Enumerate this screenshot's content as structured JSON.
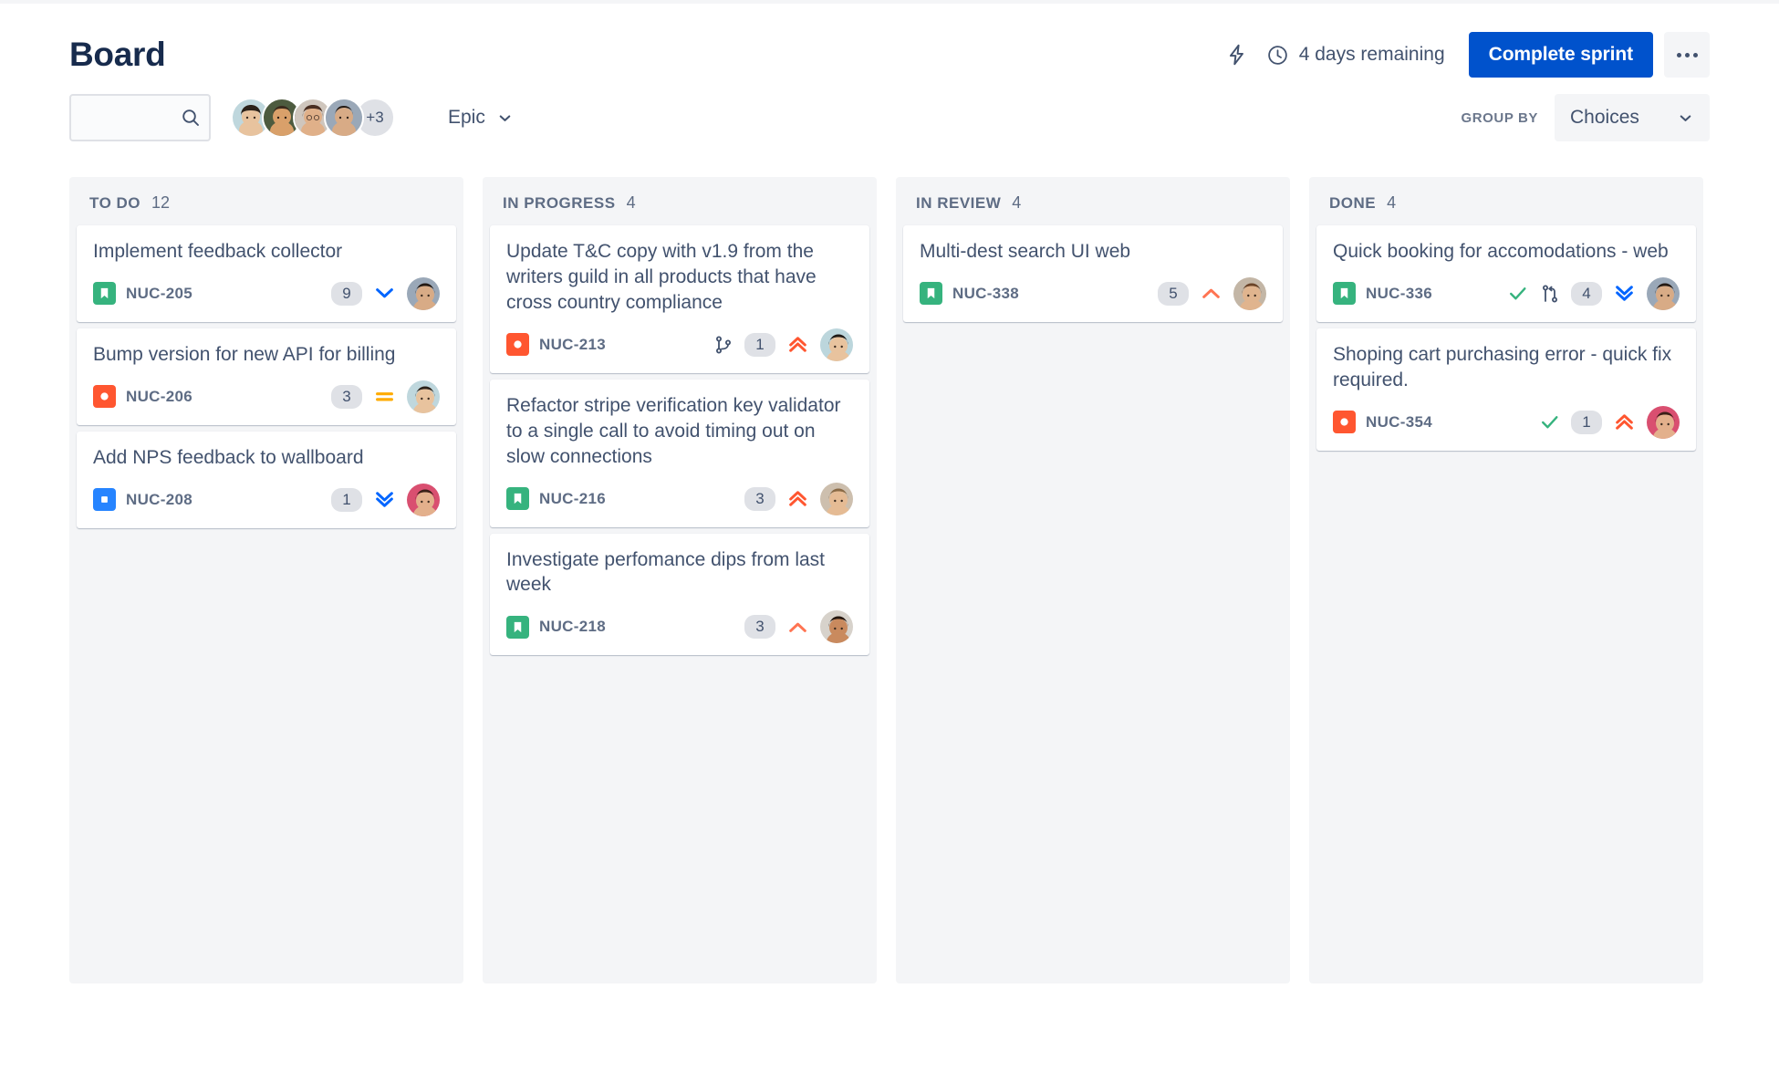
{
  "header": {
    "title": "Board",
    "lightning_icon": "lightning-bolt-icon",
    "clock_icon": "clock-icon",
    "days_remaining": "4 days remaining",
    "complete_sprint_label": "Complete sprint",
    "more_actions_icon": "ellipsis-icon"
  },
  "toolbar": {
    "search": {
      "value": "",
      "placeholder": "",
      "icon": "search-icon"
    },
    "avatars": [
      {
        "name": "avatar-1",
        "skin": "#e8c39e",
        "hair": "#2b2119",
        "bg": "#c9dde2"
      },
      {
        "name": "avatar-2",
        "skin": "#d9a06a",
        "hair": "#3b2a1d",
        "bg": "#4d5b3f"
      },
      {
        "name": "avatar-3",
        "skin": "#e0b089",
        "hair": "#4a2f22",
        "bg": "#cfc6bd"
      },
      {
        "name": "avatar-4",
        "skin": "#d8ab86",
        "hair": "#241a14",
        "bg": "#9aa8b8"
      }
    ],
    "avatar_overflow": "+3",
    "epic_label": "Epic",
    "group_by_label": "GROUP BY",
    "group_by_value": "Choices",
    "chevron_icon": "chevron-down-icon"
  },
  "colors": {
    "brand_blue": "#0052cc",
    "story_green": "#36b37e",
    "bug_red": "#ff5630",
    "task_blue": "#2684ff",
    "priority_highest": "#ff5630",
    "priority_high": "#ff7452",
    "priority_medium": "#ffab00",
    "priority_low": "#0065ff",
    "column_bg": "#f4f5f7",
    "text_primary": "#172b4d",
    "text_secondary": "#42526e",
    "text_muted": "#5e6c84"
  },
  "columns": [
    {
      "name": "TO DO",
      "count": "12",
      "cards": [
        {
          "title": "Implement feedback collector",
          "key": "NUC-205",
          "type": "story",
          "type_icon": "story-bookmark-icon",
          "count": "9",
          "priority": "low",
          "priority_icon": "chevron-down-icon",
          "check": false,
          "branch": null,
          "avatar": {
            "skin": "#d8ab86",
            "hair": "#241a14",
            "bg": "#9aa8b8"
          }
        },
        {
          "title": "Bump version for new API for billing",
          "key": "NUC-206",
          "type": "bug",
          "type_icon": "bug-circle-icon",
          "count": "3",
          "priority": "medium",
          "priority_icon": "equals-icon",
          "check": false,
          "branch": null,
          "avatar": {
            "skin": "#e8c39e",
            "hair": "#2b2119",
            "bg": "#bfd7dd"
          }
        },
        {
          "title": "Add NPS feedback to wallboard",
          "key": "NUC-208",
          "type": "task",
          "type_icon": "task-square-icon",
          "count": "1",
          "priority": "lowest",
          "priority_icon": "double-chevron-down-icon",
          "check": false,
          "branch": null,
          "avatar": {
            "skin": "#e3b08c",
            "hair": "#3a2018",
            "bg": "#d94f70"
          }
        }
      ]
    },
    {
      "name": "IN PROGRESS",
      "count": "4",
      "cards": [
        {
          "title": "Update T&C copy with v1.9 from the writers guild in all products that have cross country compliance",
          "key": "NUC-213",
          "type": "bug",
          "type_icon": "bug-circle-icon",
          "count": "1",
          "priority": "highest",
          "priority_icon": "double-chevron-up-icon",
          "check": false,
          "branch": "branch-icon",
          "avatar": {
            "skin": "#e8c39e",
            "hair": "#1f1a16",
            "bg": "#bcd6dc"
          }
        },
        {
          "title": "Refactor stripe verification key validator to a single call to avoid timing out on slow connections",
          "key": "NUC-216",
          "type": "story",
          "type_icon": "story-bookmark-icon",
          "count": "3",
          "priority": "highest",
          "priority_icon": "double-chevron-up-icon",
          "check": false,
          "branch": null,
          "avatar": {
            "skin": "#e5bb94",
            "hair": "#8a6a45",
            "bg": "#cdbfae"
          }
        },
        {
          "title": "Investigate perfomance dips from last week",
          "key": "NUC-218",
          "type": "story",
          "type_icon": "story-bookmark-icon",
          "count": "3",
          "priority": "high",
          "priority_icon": "chevron-up-icon",
          "check": false,
          "branch": null,
          "avatar": {
            "skin": "#c98a5e",
            "hair": "#24160f",
            "bg": "#d7d2cb"
          }
        }
      ]
    },
    {
      "name": "IN REVIEW",
      "count": "4",
      "cards": [
        {
          "title": "Multi-dest search UI web",
          "key": "NUC-338",
          "type": "story",
          "type_icon": "story-bookmark-icon",
          "count": "5",
          "priority": "high",
          "priority_icon": "chevron-up-icon",
          "check": false,
          "branch": null,
          "avatar": {
            "skin": "#e0b48e",
            "hair": "#6b4428",
            "bg": "#c3b6a6"
          }
        }
      ]
    },
    {
      "name": "DONE",
      "count": "4",
      "cards": [
        {
          "title": "Quick booking for accomodations - web",
          "key": "NUC-336",
          "type": "story",
          "type_icon": "story-bookmark-icon",
          "count": "4",
          "priority": "lowest",
          "priority_icon": "double-chevron-down-icon",
          "check": true,
          "check_icon": "check-icon",
          "branch": "pull-request-icon",
          "avatar": {
            "skin": "#d8ab86",
            "hair": "#241a14",
            "bg": "#9aa8b8"
          }
        },
        {
          "title": "Shoping cart purchasing error - quick fix required.",
          "key": "NUC-354",
          "type": "bug",
          "type_icon": "bug-circle-icon",
          "count": "1",
          "priority": "highest",
          "priority_icon": "double-chevron-up-icon",
          "check": true,
          "check_icon": "check-icon",
          "branch": null,
          "avatar": {
            "skin": "#e3b08c",
            "hair": "#3a2018",
            "bg": "#d94f70"
          }
        }
      ]
    }
  ]
}
